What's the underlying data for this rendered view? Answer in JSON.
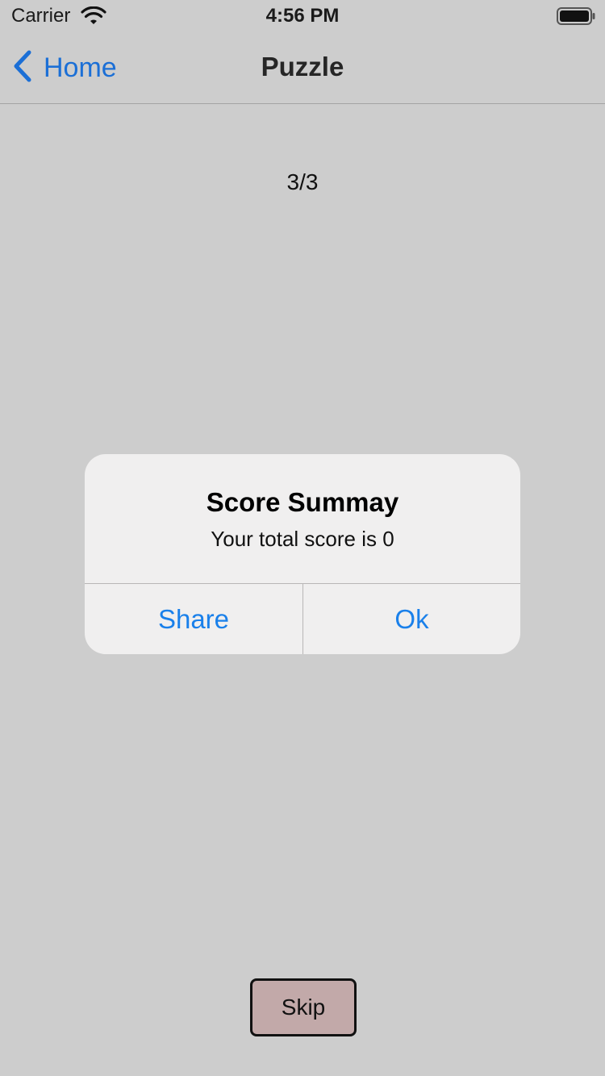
{
  "status_bar": {
    "carrier": "Carrier",
    "time": "4:56 PM",
    "icons": [
      "wifi-icon",
      "battery-icon"
    ]
  },
  "nav": {
    "back_label": "Home",
    "back_icon": "chevron-left-icon",
    "title": "Puzzle"
  },
  "progress": "3/3",
  "alert": {
    "title": "Score Summay",
    "message": "Your total score is 0",
    "buttons": [
      {
        "label": "Share"
      },
      {
        "label": "Ok"
      }
    ]
  },
  "skip_label": "Skip",
  "colors": {
    "background": "#cdcdcd",
    "accent": "#1a80ea",
    "nav_accent": "#1b6fd6",
    "alert_background": "#f0efef",
    "skip_background": "#c2a9a9"
  }
}
